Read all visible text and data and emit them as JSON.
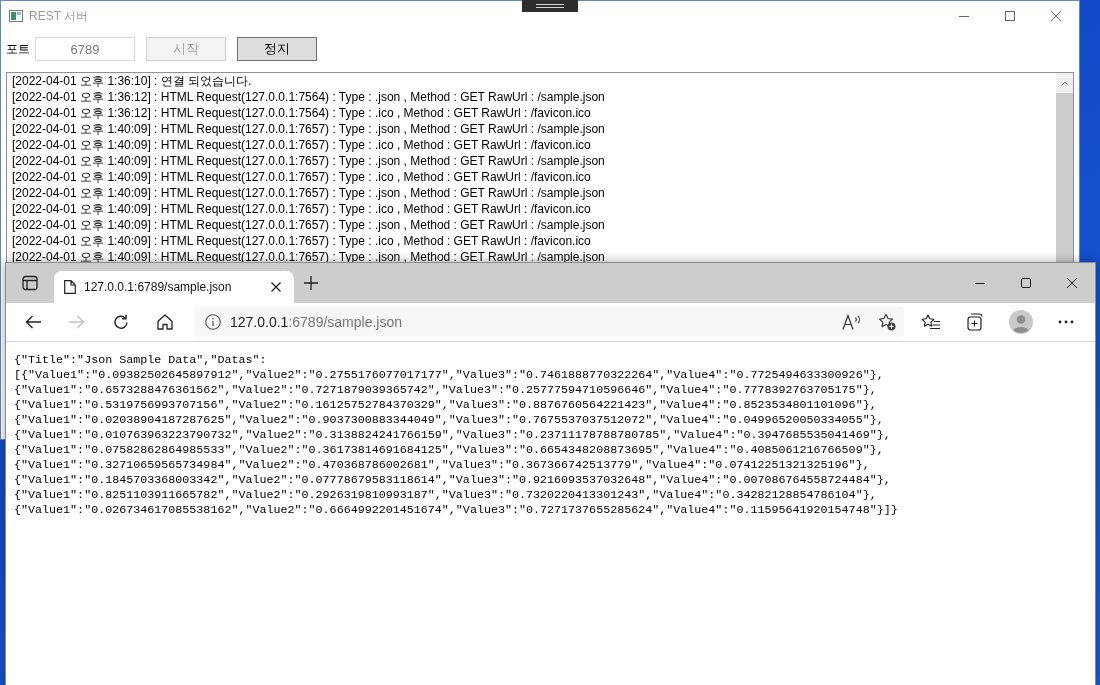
{
  "server_window": {
    "title": "REST 서버",
    "focused": false,
    "port_label": "포트",
    "port_field": {
      "value": "6789",
      "disabled": true
    },
    "buttons": [
      {
        "label": "시작",
        "disabled": true
      },
      {
        "label": "정지",
        "disabled": false
      }
    ],
    "log": [
      "[2022-04-01 오후 1:36:10] : 연결 되었습니다.",
      "[2022-04-01 오후 1:36:12] : HTML Request(127.0.0.1:7564) : Type : .json , Method : GET RawUrl : /sample.json",
      "[2022-04-01 오후 1:36:12] : HTML Request(127.0.0.1:7564) : Type : .ico , Method : GET RawUrl : /favicon.ico",
      "[2022-04-01 오후 1:40:09] : HTML Request(127.0.0.1:7657) : Type : .json , Method : GET RawUrl : /sample.json",
      "[2022-04-01 오후 1:40:09] : HTML Request(127.0.0.1:7657) : Type : .ico , Method : GET RawUrl : /favicon.ico",
      "[2022-04-01 오후 1:40:09] : HTML Request(127.0.0.1:7657) : Type : .json , Method : GET RawUrl : /sample.json",
      "[2022-04-01 오후 1:40:09] : HTML Request(127.0.0.1:7657) : Type : .ico , Method : GET RawUrl : /favicon.ico",
      "[2022-04-01 오후 1:40:09] : HTML Request(127.0.0.1:7657) : Type : .json , Method : GET RawUrl : /sample.json",
      "[2022-04-01 오후 1:40:09] : HTML Request(127.0.0.1:7657) : Type : .ico , Method : GET RawUrl : /favicon.ico",
      "[2022-04-01 오후 1:40:09] : HTML Request(127.0.0.1:7657) : Type : .json , Method : GET RawUrl : /sample.json",
      "[2022-04-01 오후 1:40:09] : HTML Request(127.0.0.1:7657) : Type : .ico , Method : GET RawUrl : /favicon.ico",
      "[2022-04-01 오후 1:40:09] : HTML Request(127.0.0.1:7657) : Type : .json , Method : GET RawUrl : /sample.json"
    ]
  },
  "browser": {
    "tabs": [
      {
        "title": "127.0.0.1:6789/sample.json",
        "selected": true
      }
    ],
    "nav_buttons": [
      {
        "kind": "back",
        "disabled": false
      },
      {
        "kind": "forward",
        "disabled": true
      },
      {
        "kind": "refresh",
        "disabled": false
      },
      {
        "kind": "home",
        "disabled": false
      }
    ],
    "address": {
      "host": "127.0.0.1",
      "path": ":6789/sample.json"
    },
    "content_lines": [
      "{\"Title\":\"Json Sample Data\",\"Datas\":",
      "[{\"Value1\":\"0.09382502645897912\",\"Value2\":\"0.2755176077017177\",\"Value3\":\"0.7461888770322264\",\"Value4\":\"0.7725494633300926\"},",
      "{\"Value1\":\"0.6573288476361562\",\"Value2\":\"0.7271879039365742\",\"Value3\":\"0.25777594710596646\",\"Value4\":\"0.7778392763705175\"},",
      "{\"Value1\":\"0.5319756993707156\",\"Value2\":\"0.16125752784370329\",\"Value3\":\"0.8876760564221423\",\"Value4\":\"0.8523534801101096\"},",
      "{\"Value1\":\"0.02038904187287625\",\"Value2\":\"0.9037300883344049\",\"Value3\":\"0.7675537037512072\",\"Value4\":\"0.04996520050334055\"},",
      "{\"Value1\":\"0.010763963223790732\",\"Value2\":\"0.3138824241766159\",\"Value3\":\"0.23711178788780785\",\"Value4\":\"0.3947685535041469\"},",
      "{\"Value1\":\"0.07582862864985533\",\"Value2\":\"0.36173814691684125\",\"Value3\":\"0.6654348208873695\",\"Value4\":\"0.4085061216766509\"},",
      "{\"Value1\":\"0.32710659565734984\",\"Value2\":\"0.470368786002681\",\"Value3\":\"0.367366742513779\",\"Value4\":\"0.07412251321325196\"},",
      "{\"Value1\":\"0.1845703368003342\",\"Value2\":\"0.07778679583118614\",\"Value3\":\"0.9216093537032648\",\"Value4\":\"0.007086764558724484\"},",
      "{\"Value1\":\"0.8251103911665782\",\"Value2\":\"0.2926319810993187\",\"Value3\":\"0.7320220413301243\",\"Value4\":\"0.34282128854786104\"},",
      "{\"Value1\":\"0.026734617085538162\",\"Value2\":\"0.6664992201451674\",\"Value3\":\"0.7271737655285624\",\"Value4\":\"0.11595641920154748\"}]}"
    ]
  }
}
